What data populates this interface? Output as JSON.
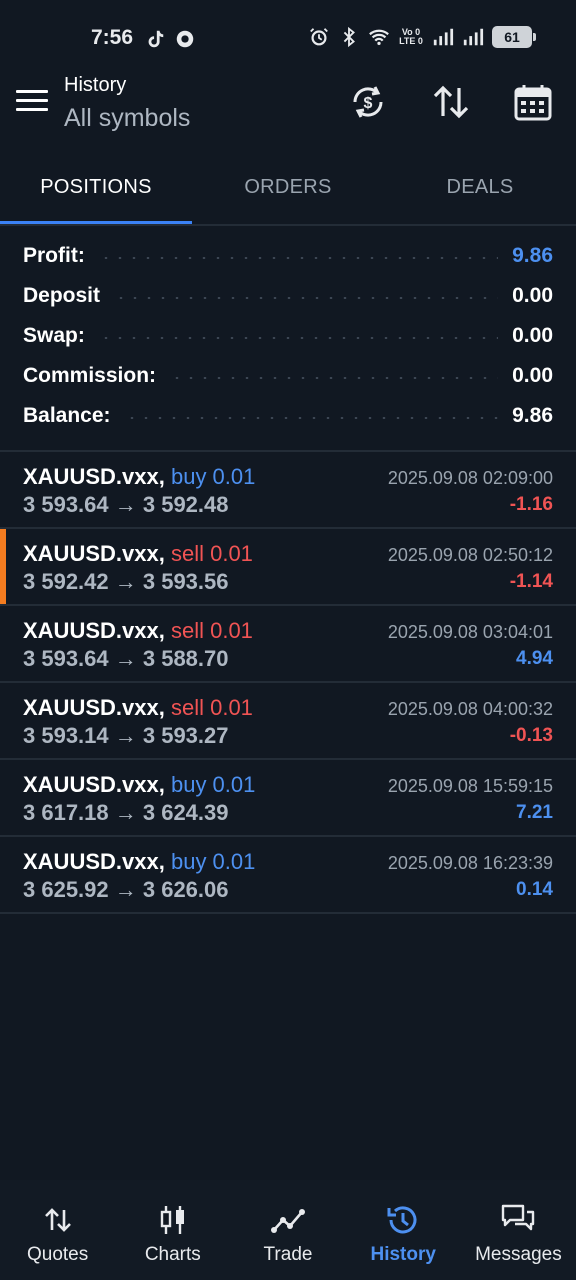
{
  "status_bar": {
    "time": "7:56",
    "network_label_top": "Vo 0",
    "network_label_bottom": "LTE 0",
    "battery": "61"
  },
  "appbar": {
    "title": "History",
    "subtitle": "All symbols"
  },
  "tabs": [
    {
      "label": "POSITIONS",
      "active": true
    },
    {
      "label": "ORDERS",
      "active": false
    },
    {
      "label": "DEALS",
      "active": false
    }
  ],
  "summary": {
    "profit_label": "Profit:",
    "profit_value": "9.86",
    "deposit_label": "Deposit",
    "deposit_value": "0.00",
    "swap_label": "Swap:",
    "swap_value": "0.00",
    "commission_label": "Commission:",
    "commission_value": "0.00",
    "balance_label": "Balance:",
    "balance_value": "9.86"
  },
  "deals": [
    {
      "symbol": "XAUUSD.vxx,",
      "side": "buy 0.01",
      "prices": "3 593.64 → 3 592.48",
      "time": "2025.09.08 02:09:00",
      "profit": "-1.16"
    },
    {
      "symbol": "XAUUSD.vxx,",
      "side": "sell 0.01",
      "prices": "3 592.42 → 3 593.56",
      "time": "2025.09.08 02:50:12",
      "profit": "-1.14"
    },
    {
      "symbol": "XAUUSD.vxx,",
      "side": "sell 0.01",
      "prices": "3 593.64 → 3 588.70",
      "time": "2025.09.08 03:04:01",
      "profit": "4.94"
    },
    {
      "symbol": "XAUUSD.vxx,",
      "side": "sell 0.01",
      "prices": "3 593.14 → 3 593.27",
      "time": "2025.09.08 04:00:32",
      "profit": "-0.13"
    },
    {
      "symbol": "XAUUSD.vxx,",
      "side": "buy 0.01",
      "prices": "3 617.18 → 3 624.39",
      "time": "2025.09.08 15:59:15",
      "profit": "7.21"
    },
    {
      "symbol": "XAUUSD.vxx,",
      "side": "buy 0.01",
      "prices": "3 625.92 → 3 626.06",
      "time": "2025.09.08 16:23:39",
      "profit": "0.14"
    }
  ],
  "bottom_nav": [
    {
      "label": "Quotes",
      "icon": "arrows-updown-icon",
      "active": false
    },
    {
      "label": "Charts",
      "icon": "candlestick-icon",
      "active": false
    },
    {
      "label": "Trade",
      "icon": "trend-line-icon",
      "active": false
    },
    {
      "label": "History",
      "icon": "history-clock-icon",
      "active": true
    },
    {
      "label": "Messages",
      "icon": "chat-bubbles-icon",
      "active": false
    }
  ],
  "colors": {
    "background": "#111822",
    "accent_blue": "#4d90f0",
    "loss_red": "#f05454",
    "marker_orange": "#f47c20"
  }
}
